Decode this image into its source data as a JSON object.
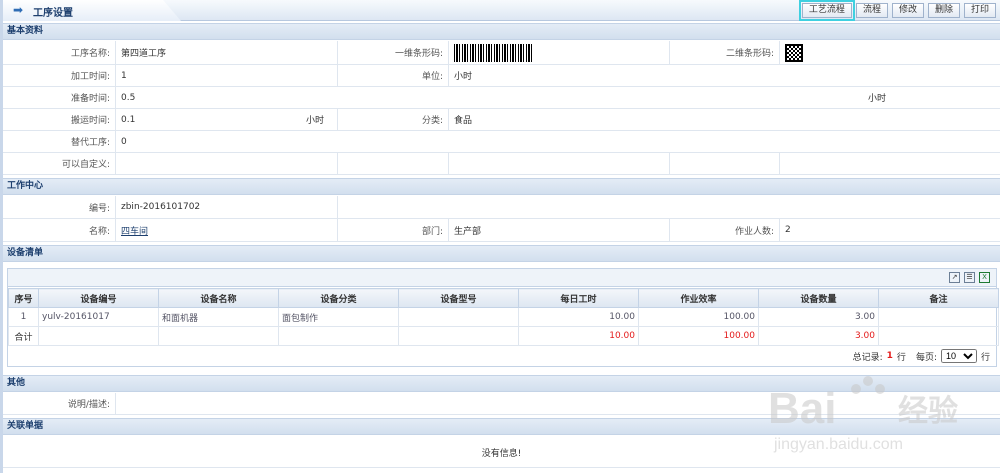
{
  "header": {
    "title": "工序设置",
    "buttons": [
      "工艺流程",
      "流程",
      "修改",
      "删除",
      "打印"
    ]
  },
  "basic": {
    "section_title": "基本资料",
    "process_name_label": "工序名称:",
    "process_name": "第四道工序",
    "barcode1_label": "一维条形码:",
    "barcode2_label": "二维条形码:",
    "proc_time_label": "加工时间:",
    "proc_time": "1",
    "unit_label": "单位:",
    "unit": "小时",
    "prep_time_label": "准备时间:",
    "prep_time": "0.5",
    "prep_unit": "小时",
    "move_time_label": "搬运时间:",
    "move_time": "0.1",
    "move_unit": "小时",
    "category_label": "分类:",
    "category": "食品",
    "alt_label": "替代工序:",
    "alt": "0",
    "custom_label": "可以自定义:"
  },
  "workcenter": {
    "section_title": "工作中心",
    "code_label": "编号:",
    "code": "zbin-2016101702",
    "name_label": "名称:",
    "name": "四车间",
    "dept_label": "部门:",
    "dept": "生产部",
    "workers_label": "作业人数:",
    "workers": "2"
  },
  "equipment": {
    "section_title": "设备清单",
    "columns": [
      "序号",
      "设备编号",
      "设备名称",
      "设备分类",
      "设备型号",
      "每日工时",
      "作业效率",
      "设备数量",
      "备注"
    ],
    "rows": [
      {
        "seq": "1",
        "code": "yulv-20161017",
        "name": "和面机器",
        "cat": "面包制作",
        "model": "",
        "hours": "10.00",
        "eff": "100.00",
        "qty": "3.00",
        "note": ""
      }
    ],
    "total": {
      "label": "合计",
      "hours": "10.00",
      "eff": "100.00",
      "qty": "3.00"
    },
    "pager": {
      "total_prefix": "总记录:",
      "total_count": "1",
      "total_suffix": "行",
      "per_page_label": "每页:",
      "per_page": "10",
      "per_page_suffix": "行"
    }
  },
  "other": {
    "section_title": "其他",
    "desc_label": "说明/描述:"
  },
  "related": {
    "section_title": "关联单据",
    "empty": "没有信息!"
  },
  "watermark": {
    "text1": "Bai",
    "text2": "经验",
    "url": "jingyan.baidu.com"
  }
}
